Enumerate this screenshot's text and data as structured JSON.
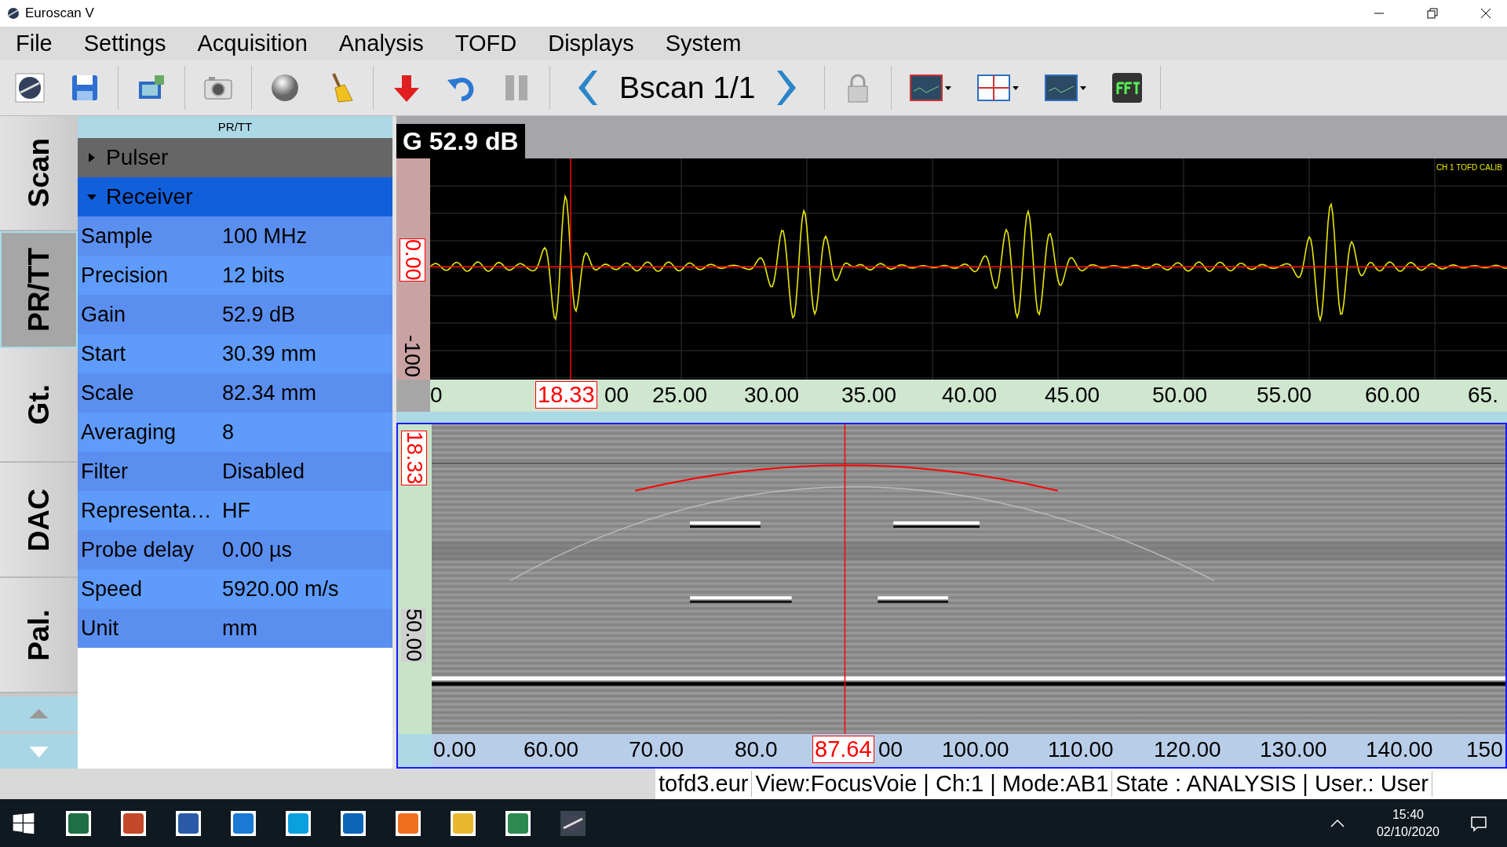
{
  "window": {
    "title": "Euroscan V"
  },
  "menu": [
    "File",
    "Settings",
    "Acquisition",
    "Analysis",
    "TOFD",
    "Displays",
    "System"
  ],
  "toolbar": {
    "view_label": "Bscan 1/1"
  },
  "side_tabs": [
    {
      "label": "Scan",
      "selected": false
    },
    {
      "label": "PR/TT",
      "selected": true
    },
    {
      "label": "Gt.",
      "selected": false
    },
    {
      "label": "DAC",
      "selected": false
    },
    {
      "label": "Pal.",
      "selected": false
    }
  ],
  "panel": {
    "title": "PR/TT",
    "sections": [
      {
        "label": "Pulser",
        "expanded": false,
        "selected": false
      },
      {
        "label": "Receiver",
        "expanded": true,
        "selected": true,
        "rows": [
          {
            "name": "Sample",
            "value": "100 MHz"
          },
          {
            "name": "Precision",
            "value": "12 bits"
          },
          {
            "name": "Gain",
            "value": "52.9 dB"
          },
          {
            "name": "Start",
            "value": "30.39 mm"
          },
          {
            "name": "Scale",
            "value": "82.34 mm"
          },
          {
            "name": "Averaging",
            "value": "8"
          },
          {
            "name": "Filter",
            "value": "Disabled"
          },
          {
            "name": "Representa…",
            "value": "HF"
          },
          {
            "name": "Probe delay",
            "value": "0.00 µs"
          },
          {
            "name": "Speed",
            "value": "5920.00 m/s"
          },
          {
            "name": "Unit",
            "value": "mm"
          }
        ]
      }
    ]
  },
  "ascan": {
    "gain": "G 52.9 dB",
    "channel_label": "CH 1 TOFD CALIB",
    "y_labels": [
      "0.00",
      "-100"
    ],
    "cursor": "18.33",
    "x_ticks": [
      "0",
      "00",
      "25.00",
      "30.00",
      "35.00",
      "40.00",
      "45.00",
      "50.00",
      "55.00",
      "60.00",
      "65."
    ]
  },
  "bscan": {
    "y_cursor": "18.33",
    "y_label": "50.00",
    "x_cursor": "87.64",
    "x_ticks": [
      "0.00",
      "60.00",
      "70.00",
      "80.0",
      "00",
      "100.00",
      "110.00",
      "120.00",
      "130.00",
      "140.00",
      "150"
    ]
  },
  "status_bar": [
    "tofd3.eur",
    "View:FocusVoie | Ch:1 | Mode:AB1",
    "State : ANALYSIS | User.: User"
  ],
  "taskbar": {
    "time": "15:40",
    "date": "02/10/2020"
  }
}
